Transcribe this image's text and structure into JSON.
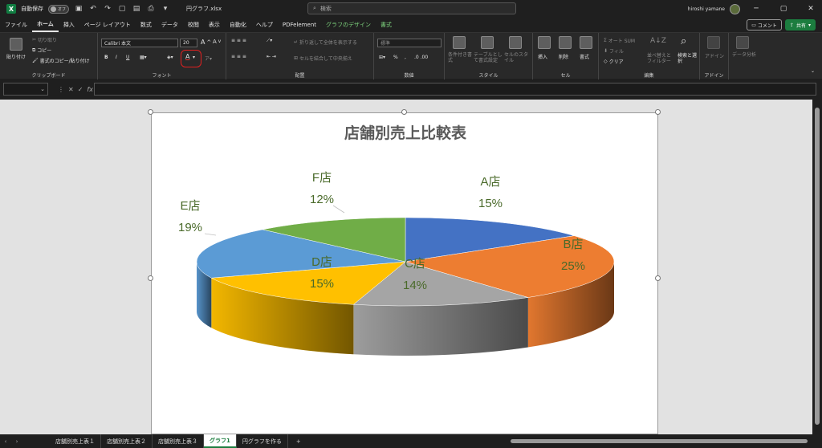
{
  "titlebar": {
    "autosave_label": "自動保存",
    "autosave_state": "オフ",
    "file_name": "円グラフ.xlsx",
    "search_placeholder": "検索",
    "user_name": "hiroshi yamane"
  },
  "menu": {
    "items": [
      "ファイル",
      "ホーム",
      "挿入",
      "ページ レイアウト",
      "数式",
      "データ",
      "校閲",
      "表示",
      "自動化",
      "ヘルプ",
      "PDFelement"
    ],
    "context_items": [
      "グラフのデザイン",
      "書式"
    ],
    "comment_label": "コメント",
    "share_label": "共有"
  },
  "ribbon": {
    "clipboard": {
      "paste": "貼り付け",
      "cut": "切り取り",
      "copy": "コピー",
      "format_painter": "書式のコピー/貼り付け",
      "label": "クリップボード"
    },
    "font": {
      "font_name": "Calibri 本文",
      "font_size": "20",
      "bold": "B",
      "italic": "I",
      "underline": "U",
      "font_color": "A",
      "label": "フォント"
    },
    "alignment": {
      "wrap": "折り返して全体を表示する",
      "merge": "セルを結合して中央揃え",
      "label": "配置"
    },
    "number": {
      "format": "標準",
      "label": "数値"
    },
    "styles": {
      "conditional": "条件付き書式",
      "table": "テーブルとして書式設定",
      "cell": "セルのスタイル",
      "label": "スタイル"
    },
    "cells": {
      "insert": "挿入",
      "delete": "削除",
      "format": "書式",
      "label": "セル"
    },
    "editing": {
      "autosum": "オート SUM",
      "fill": "フィル",
      "clear": "クリア",
      "sort": "並べ替えとフィルター",
      "find": "検索と選択",
      "label": "編集"
    },
    "addins": {
      "addin": "アドイン",
      "analyze": "データ分析",
      "label": "アドイン"
    }
  },
  "formula_bar": {
    "fx": "fx"
  },
  "sheets": {
    "tabs": [
      "店舗別売上表１",
      "店舗別売上表２",
      "店舗別売上表３",
      "グラフ1",
      "円グラフを作る"
    ],
    "active_index": 3,
    "add": "+"
  },
  "colors": {
    "A": "#4472c4",
    "B": "#ed7d31",
    "C": "#a5a5a5",
    "D": "#ffc000",
    "E": "#5b9bd5",
    "F": "#70ad47",
    "label": "#4a6a2a"
  },
  "chart_data": {
    "type": "pie",
    "title": "店舗別売上比較表",
    "categories": [
      "A店",
      "B店",
      "C店",
      "D店",
      "E店",
      "F店"
    ],
    "values": [
      15,
      25,
      14,
      15,
      19,
      12
    ],
    "labels": [
      "15%",
      "25%",
      "14%",
      "15%",
      "19%",
      "12%"
    ],
    "style": "3d"
  }
}
